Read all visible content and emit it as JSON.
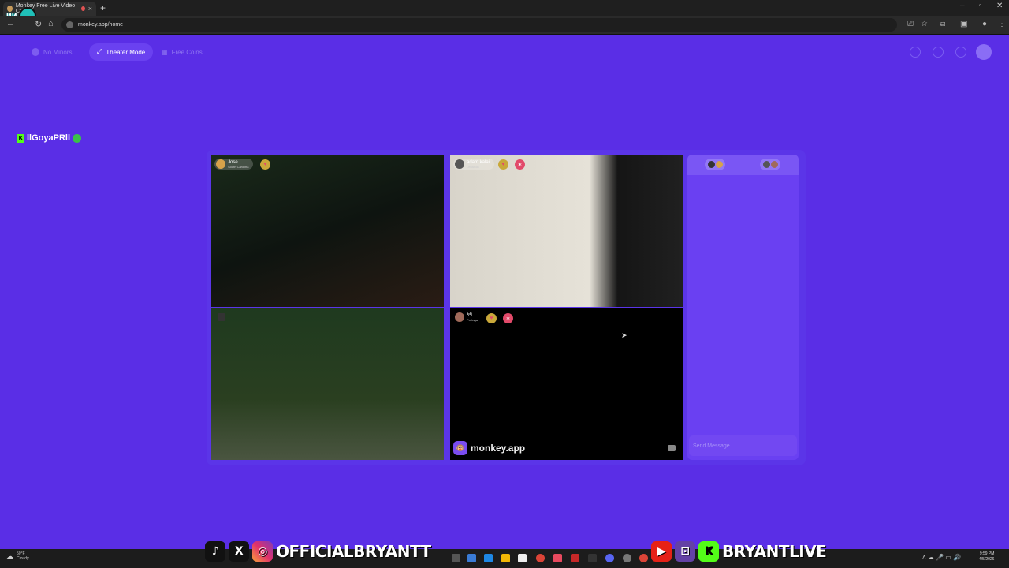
{
  "browser": {
    "tab_title": "Monkey Free Live Video Ch...",
    "url": "monkey.app/home"
  },
  "nav": {
    "no_minors": "No Minors",
    "theater_mode": "Theater Mode",
    "free_coins": "Free Coins"
  },
  "streamer_tag": "llGoyaPRll",
  "tiles": [
    {
      "name": "Jose",
      "location": "South Carolina"
    },
    {
      "name": "adam kalai",
      "location": "Lebanon"
    },
    {
      "name": "",
      "location": ""
    },
    {
      "name": "보l",
      "location": "Portugal"
    }
  ],
  "brand": "monkey.app",
  "chat": {
    "placeholder": "Send Message"
  },
  "socials": {
    "left_handle": "OFFICIALBRYANTT",
    "right_handle": "BRYANTLIVE"
  },
  "taskbar": {
    "weather_temp": "50°F",
    "weather_desc": "Cloudy",
    "time": "9:59 PM",
    "date": "4/5/2026"
  }
}
